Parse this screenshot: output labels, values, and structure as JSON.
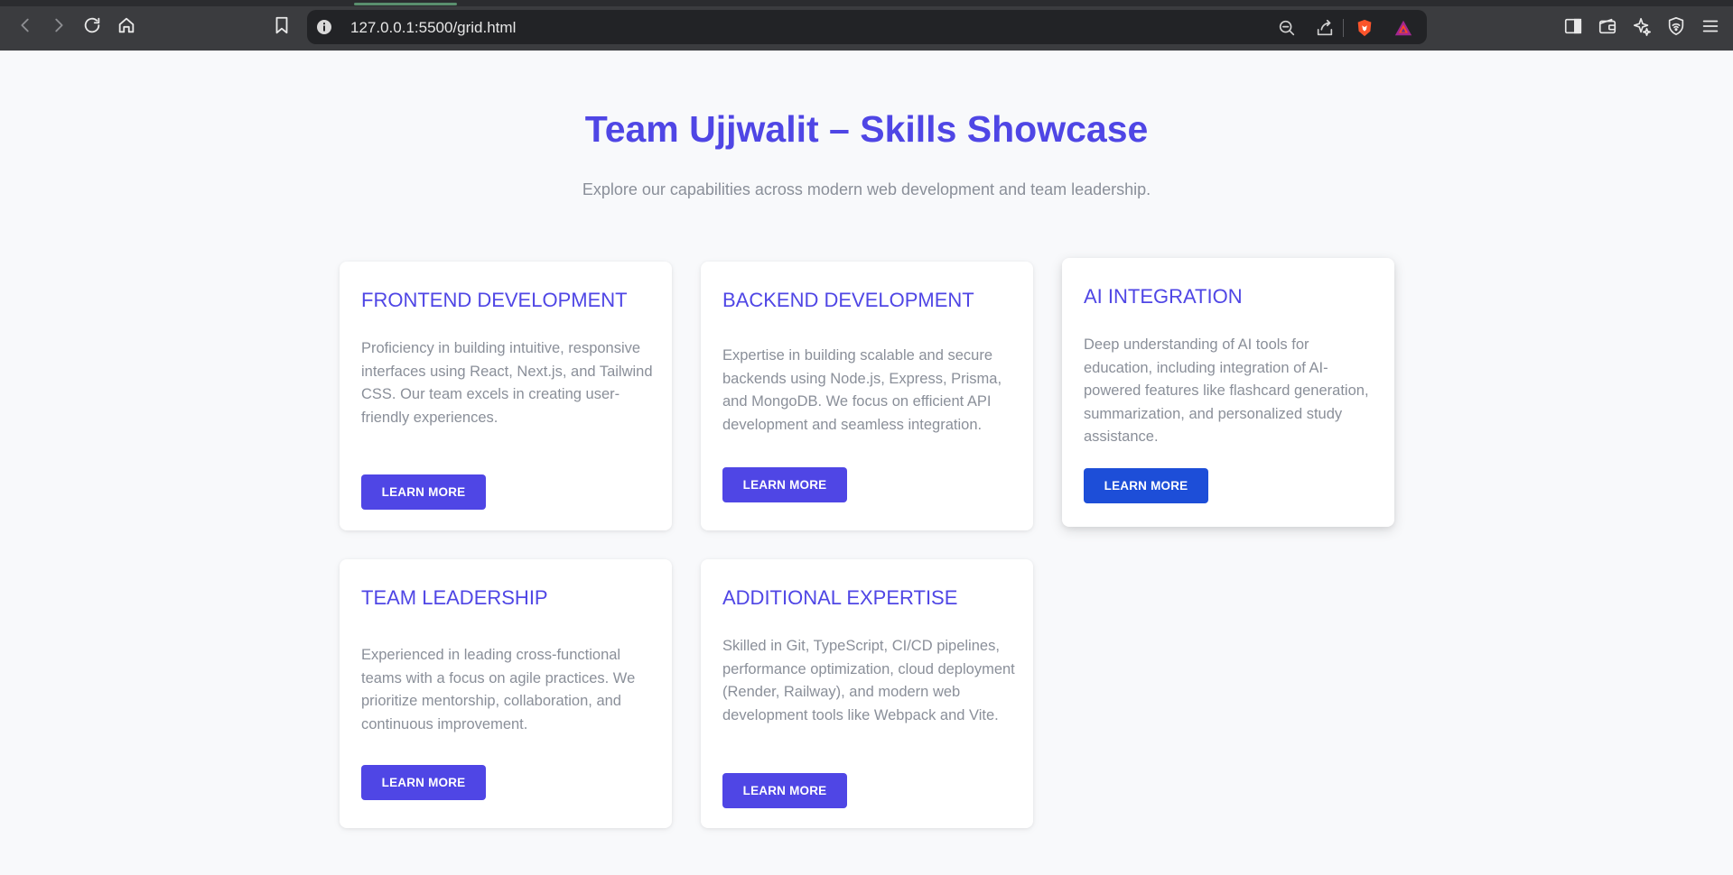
{
  "browser": {
    "url": "127.0.0.1:5500/grid.html"
  },
  "page": {
    "title": "Team Ujjwalit – Skills Showcase",
    "subtitle": "Explore our capabilities across modern web development and team leadership."
  },
  "cards": [
    {
      "title": "FRONTEND DEVELOPMENT",
      "description": "Proficiency in building intuitive, responsive interfaces using React, Next.js, and Tailwind CSS. Our team excels in creating user-friendly experiences.",
      "button": "LEARN MORE"
    },
    {
      "title": "BACKEND DEVELOPMENT",
      "description": "Expertise in building scalable and secure backends using Node.js, Express, Prisma, and MongoDB. We focus on efficient API development and seamless integration.",
      "button": "LEARN MORE"
    },
    {
      "title": "AI INTEGRATION",
      "description": "Deep understanding of AI tools for education, including integration of AI-powered features like flashcard generation, summarization, and personalized study assistance.",
      "button": "LEARN MORE"
    },
    {
      "title": "TEAM LEADERSHIP",
      "description": "Experienced in leading cross-functional teams with a focus on agile practices. We prioritize mentorship, collaboration, and continuous improvement.",
      "button": "LEARN MORE"
    },
    {
      "title": "ADDITIONAL EXPERTISE",
      "description": "Skilled in Git, TypeScript, CI/CD pipelines, performance optimization, cloud deployment (Render, Railway), and modern web development tools like Webpack and Vite.",
      "button": "LEARN MORE"
    }
  ],
  "colors": {
    "accent": "#4f46e5",
    "button_highlight": "#1d4ed8",
    "text_muted": "#8a8f99",
    "page_background": "#f8f9fb"
  },
  "icons": [
    "back-icon",
    "forward-icon",
    "reload-icon",
    "home-icon",
    "bookmark-icon",
    "site-info-icon",
    "zoom-out-icon",
    "share-icon",
    "brave-shields-icon",
    "brave-rewards-icon",
    "sidebar-icon",
    "wallet-icon",
    "leo-ai-icon",
    "vpn-icon",
    "menu-icon"
  ]
}
